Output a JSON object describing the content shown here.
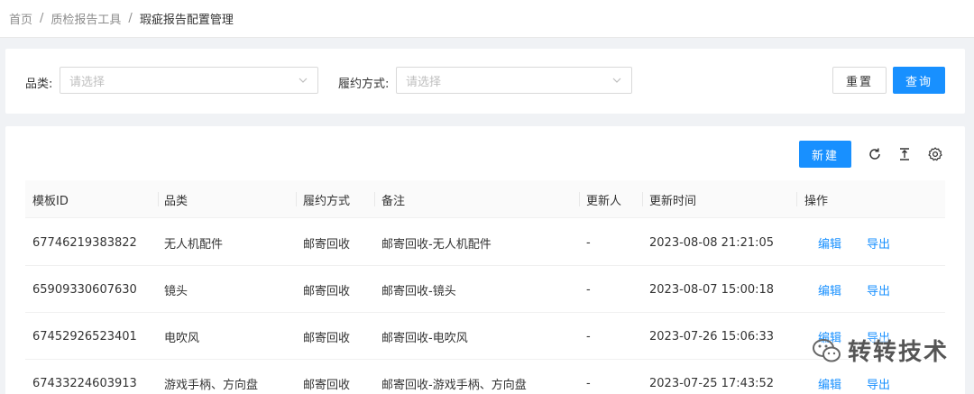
{
  "breadcrumb": {
    "home": "首页",
    "sep": "/",
    "tools": "质检报告工具",
    "current": "瑕疵报告配置管理"
  },
  "filters": {
    "category_label": "品类:",
    "category_placeholder": "请选择",
    "fulfillment_label": "履约方式:",
    "fulfillment_placeholder": "请选择",
    "reset_label": "重置",
    "query_label": "查询"
  },
  "toolbar": {
    "new_label": "新建",
    "icons": [
      "refresh-icon",
      "column-height-icon",
      "settings-icon"
    ]
  },
  "table": {
    "columns": [
      "模板ID",
      "品类",
      "履约方式",
      "备注",
      "更新人",
      "更新时间",
      "操作"
    ],
    "edit_label": "编辑",
    "export_label": "导出",
    "rows": [
      {
        "id": "67746219383822",
        "category": "无人机配件",
        "method": "邮寄回收",
        "note": "邮寄回收-无人机配件",
        "updater": "-",
        "time": "2023-08-08 21:21:05"
      },
      {
        "id": "65909330607630",
        "category": "镜头",
        "method": "邮寄回收",
        "note": "邮寄回收-镜头",
        "updater": "-",
        "time": "2023-08-07 15:00:18"
      },
      {
        "id": "67452926523401",
        "category": "电吹风",
        "method": "邮寄回收",
        "note": "邮寄回收-电吹风",
        "updater": "-",
        "time": "2023-07-26 15:06:33"
      },
      {
        "id": "67433224603913",
        "category": "游戏手柄、方向盘",
        "method": "邮寄回收",
        "note": "邮寄回收-游戏手柄、方向盘",
        "updater": "-",
        "time": "2023-07-25 17:43:52"
      }
    ]
  },
  "watermark": {
    "text": "转转技术",
    "icon": "wechat-icon"
  },
  "colors": {
    "primary": "#1890ff",
    "background": "#f0f2f5"
  }
}
